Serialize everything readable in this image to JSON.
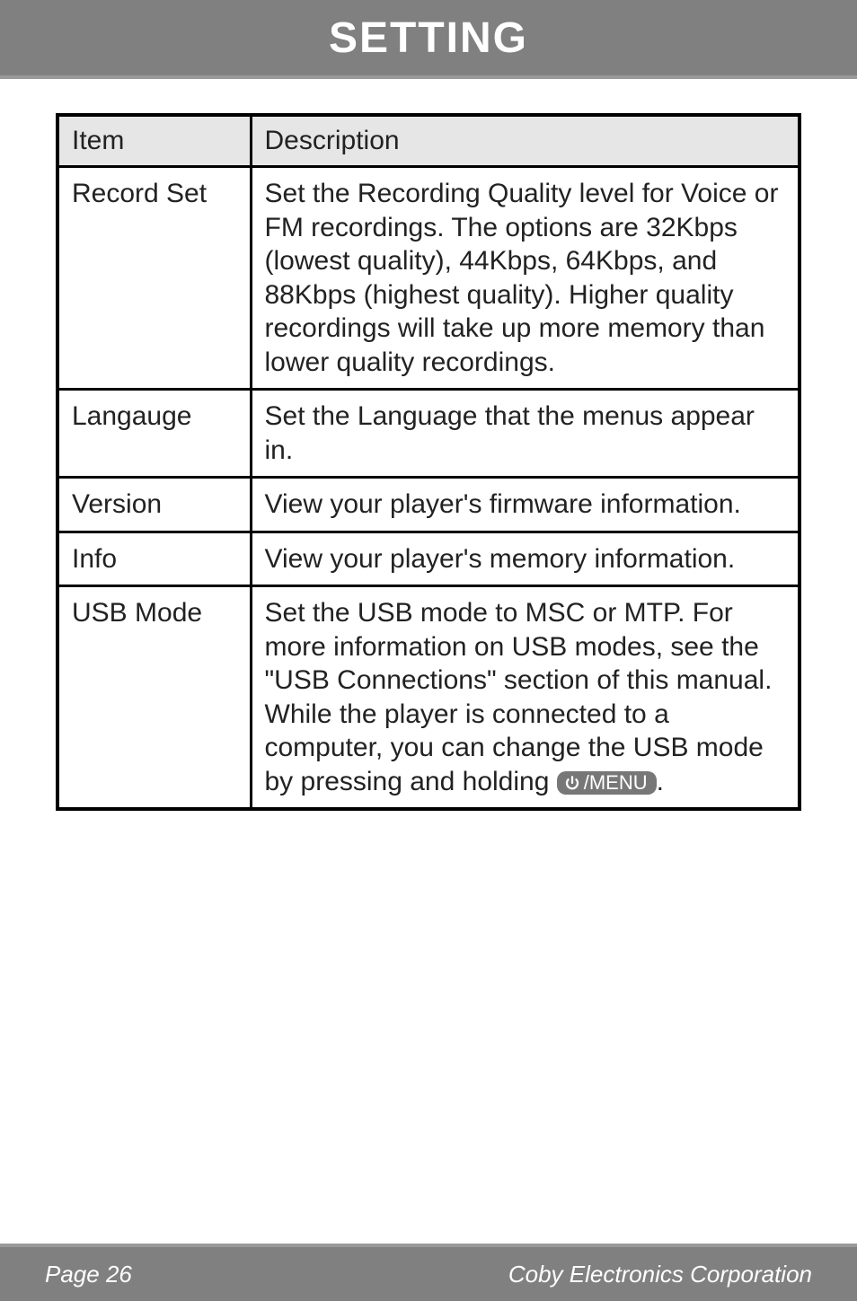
{
  "header": {
    "title": "SETTING"
  },
  "table": {
    "headers": {
      "item": "Item",
      "description": "Description"
    },
    "rows": [
      {
        "item": "Record Set",
        "description": "Set the Recording Quality level for Voice or FM recordings. The options are 32Kbps (lowest quality), 44Kbps, 64Kbps, and 88Kbps (highest quality). Higher quality recordings will take up more memory than lower quality recordings."
      },
      {
        "item": "Langauge",
        "description": "Set the Language that the menus appear in."
      },
      {
        "item": "Version",
        "description": "View your player's firmware information."
      },
      {
        "item": "Info",
        "description": "View your player's memory information."
      },
      {
        "item": "USB Mode",
        "desc_part1": "Set the USB mode to MSC or MTP. For more information on USB modes, see the \"USB Connections\" section of this manual.",
        "desc_part2": "While the player is connected to a computer, you can change the USB mode by pressing and holding ",
        "desc_menu_label": "/MENU",
        "desc_part3": "."
      }
    ]
  },
  "footer": {
    "page": "Page 26",
    "company": "Coby Electronics Corporation"
  }
}
